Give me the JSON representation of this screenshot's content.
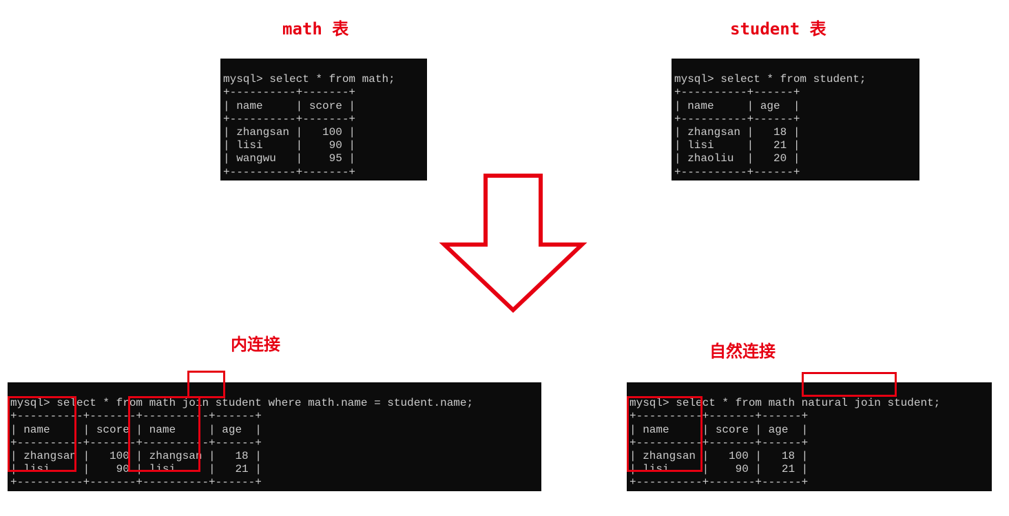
{
  "titles": {
    "math": "math 表",
    "student": "student 表",
    "inner": "内连接",
    "natural": "自然连接"
  },
  "math_table": {
    "query": "mysql> select * from math;",
    "sep_top": "+----------+-------+",
    "header": "| name     | score |",
    "sep_mid": "+----------+-------+",
    "rows": [
      "| zhangsan |   100 |",
      "| lisi     |    90 |",
      "| wangwu   |    95 |"
    ],
    "sep_bot": "+----------+-------+"
  },
  "student_table": {
    "query": "mysql> select * from student;",
    "sep_top": "+----------+------+",
    "header": "| name     | age  |",
    "sep_mid": "+----------+------+",
    "rows": [
      "| zhangsan |   18 |",
      "| lisi     |   21 |",
      "| zhaoliu  |   20 |"
    ],
    "sep_bot": "+----------+------+"
  },
  "inner_join": {
    "query": "mysql> select * from math join student where math.name = student.name;",
    "sep_top": "+----------+-------+----------+------+",
    "header": "| name     | score | name     | age  |",
    "sep_mid": "+----------+-------+----------+------+",
    "rows": [
      "| zhangsan |   100 | zhangsan |   18 |",
      "| lisi     |    90 | lisi     |   21 |"
    ],
    "sep_bot": "+----------+-------+----------+------+"
  },
  "natural_join": {
    "query": "mysql> select * from math natural join student;",
    "sep_top": "+----------+-------+------+",
    "header": "| name     | score | age  |",
    "sep_mid": "+----------+-------+------+",
    "rows": [
      "| zhangsan |   100 |   18 |",
      "| lisi     |    90 |   21 |"
    ],
    "sep_bot": "+----------+-------+------+"
  }
}
